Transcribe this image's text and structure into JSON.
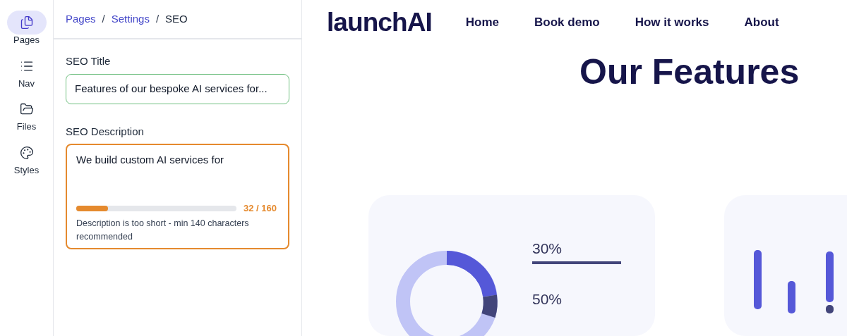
{
  "rail": [
    {
      "label": "Pages",
      "kind": "pages",
      "selected": true
    },
    {
      "label": "Nav",
      "kind": "nav",
      "selected": false
    },
    {
      "label": "Files",
      "kind": "files",
      "selected": false
    },
    {
      "label": "Styles",
      "kind": "styles",
      "selected": false
    }
  ],
  "breadcrumb": [
    {
      "label": "Pages",
      "link": true
    },
    {
      "label": "Settings",
      "link": true
    },
    {
      "label": "SEO",
      "link": false
    }
  ],
  "separator": "/",
  "seo_title": {
    "label": "SEO Title",
    "value": "Features of our bespoke AI services for..."
  },
  "seo_description": {
    "label": "SEO Description",
    "value": "We build custom AI services for",
    "level": 0.2,
    "count": "32 / 160",
    "warning": "Description is too short - min 140 characters recommended"
  },
  "preview": {
    "logo": "launchAI",
    "nav": [
      "Home",
      "Book demo",
      "How it works",
      "About"
    ],
    "heading": "Our Features",
    "stats": [
      "30%",
      "50%"
    ]
  }
}
